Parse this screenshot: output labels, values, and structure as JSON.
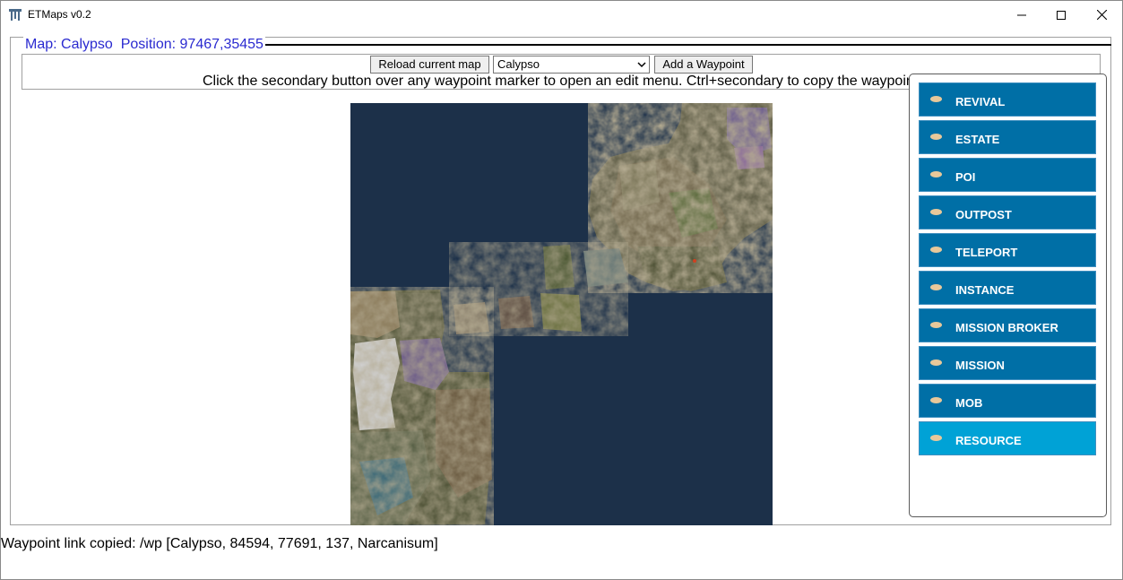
{
  "window": {
    "title": "ETMaps v0.2"
  },
  "legend": {
    "text": "Map: Calypso  Position: 97467,35455"
  },
  "toolbar": {
    "reload_label": "Reload current map",
    "map_select_value": "Calypso",
    "add_waypoint_label": "Add a Waypoint",
    "hint": "Click the secondary button over any waypoint marker to open an edit menu. Ctrl+secondary to copy the waypoint"
  },
  "categories": [
    {
      "label": "REVIVAL",
      "active": false
    },
    {
      "label": "ESTATE",
      "active": false
    },
    {
      "label": "POI",
      "active": false
    },
    {
      "label": "OUTPOST",
      "active": false
    },
    {
      "label": "TELEPORT",
      "active": false
    },
    {
      "label": "INSTANCE",
      "active": false
    },
    {
      "label": "MISSION BROKER",
      "active": false
    },
    {
      "label": "MISSION",
      "active": false
    },
    {
      "label": "MOB",
      "active": false
    },
    {
      "label": "RESOURCE",
      "active": true
    }
  ],
  "status": {
    "text": "Waypoint link copied: /wp [Calypso, 84594, 77691, 137, Narcanisum]"
  },
  "colors": {
    "accent": "#006fa6",
    "accent_active": "#00a2d6",
    "legend_text": "#2a2ad0",
    "ocean": "#1c3049"
  }
}
